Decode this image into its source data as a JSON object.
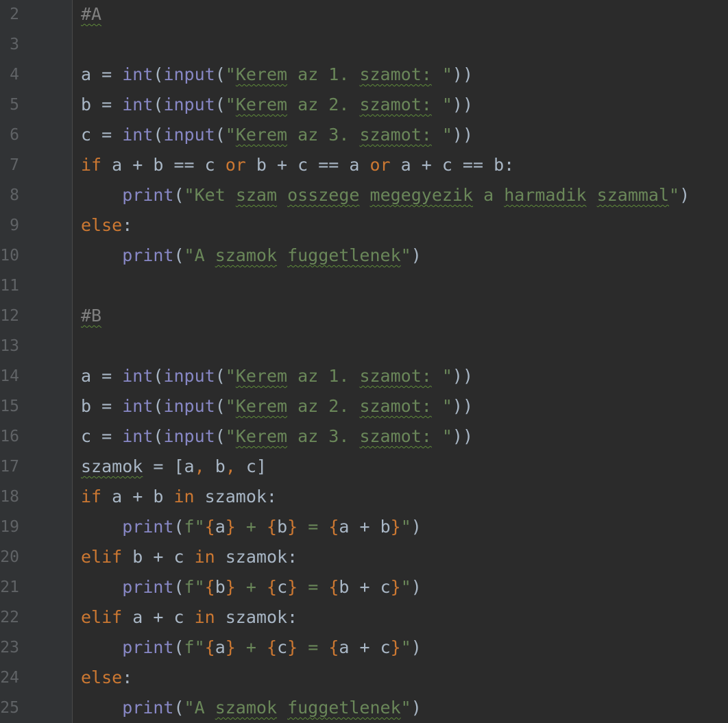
{
  "editor": {
    "lines": [
      {
        "n": "2",
        "tokens": [
          {
            "t": "#A",
            "c": "cm",
            "u": true
          }
        ]
      },
      {
        "n": "3",
        "tokens": []
      },
      {
        "n": "4",
        "tokens": [
          {
            "t": "a = "
          },
          {
            "t": "int",
            "c": "bi"
          },
          {
            "t": "("
          },
          {
            "t": "input",
            "c": "bi"
          },
          {
            "t": "("
          },
          {
            "t": "\"",
            "c": "str"
          },
          {
            "t": "Kerem",
            "c": "str",
            "u": true
          },
          {
            "t": " az 1. ",
            "c": "str"
          },
          {
            "t": "szamot:",
            "c": "str",
            "u": true
          },
          {
            "t": " \"",
            "c": "str"
          },
          {
            "t": "))"
          }
        ]
      },
      {
        "n": "5",
        "tokens": [
          {
            "t": "b = "
          },
          {
            "t": "int",
            "c": "bi"
          },
          {
            "t": "("
          },
          {
            "t": "input",
            "c": "bi"
          },
          {
            "t": "("
          },
          {
            "t": "\"",
            "c": "str"
          },
          {
            "t": "Kerem",
            "c": "str",
            "u": true
          },
          {
            "t": " az 2. ",
            "c": "str"
          },
          {
            "t": "szamot:",
            "c": "str",
            "u": true
          },
          {
            "t": " \"",
            "c": "str"
          },
          {
            "t": "))"
          }
        ]
      },
      {
        "n": "6",
        "tokens": [
          {
            "t": "c = "
          },
          {
            "t": "int",
            "c": "bi"
          },
          {
            "t": "("
          },
          {
            "t": "input",
            "c": "bi"
          },
          {
            "t": "("
          },
          {
            "t": "\"",
            "c": "str"
          },
          {
            "t": "Kerem",
            "c": "str",
            "u": true
          },
          {
            "t": " az 3. ",
            "c": "str"
          },
          {
            "t": "szamot:",
            "c": "str",
            "u": true
          },
          {
            "t": " \"",
            "c": "str"
          },
          {
            "t": "))"
          }
        ]
      },
      {
        "n": "7",
        "tokens": [
          {
            "t": "if",
            "c": "kw"
          },
          {
            "t": " a + b == c "
          },
          {
            "t": "or",
            "c": "kw"
          },
          {
            "t": " b + c == a "
          },
          {
            "t": "or",
            "c": "kw"
          },
          {
            "t": " a + c == b:"
          }
        ]
      },
      {
        "n": "8",
        "tokens": [
          {
            "t": "    "
          },
          {
            "t": "print",
            "c": "bi"
          },
          {
            "t": "("
          },
          {
            "t": "\"Ket ",
            "c": "str"
          },
          {
            "t": "szam",
            "c": "str",
            "u": true
          },
          {
            "t": " ",
            "c": "str"
          },
          {
            "t": "osszege",
            "c": "str",
            "u": true
          },
          {
            "t": " ",
            "c": "str"
          },
          {
            "t": "megegyezik",
            "c": "str",
            "u": true
          },
          {
            "t": " a ",
            "c": "str"
          },
          {
            "t": "harmadik",
            "c": "str",
            "u": true
          },
          {
            "t": " ",
            "c": "str"
          },
          {
            "t": "szammal",
            "c": "str",
            "u": true
          },
          {
            "t": "\"",
            "c": "str"
          },
          {
            "t": ")"
          }
        ]
      },
      {
        "n": "9",
        "tokens": [
          {
            "t": "else",
            "c": "kw"
          },
          {
            "t": ":"
          }
        ]
      },
      {
        "n": "10",
        "tokens": [
          {
            "t": "    "
          },
          {
            "t": "print",
            "c": "bi"
          },
          {
            "t": "("
          },
          {
            "t": "\"A ",
            "c": "str"
          },
          {
            "t": "szamok",
            "c": "str",
            "u": true
          },
          {
            "t": " ",
            "c": "str"
          },
          {
            "t": "fuggetlenek",
            "c": "str",
            "u": true
          },
          {
            "t": "\"",
            "c": "str"
          },
          {
            "t": ")"
          }
        ]
      },
      {
        "n": "11",
        "tokens": []
      },
      {
        "n": "12",
        "tokens": [
          {
            "t": "#B",
            "c": "cm",
            "u": true
          }
        ]
      },
      {
        "n": "13",
        "tokens": []
      },
      {
        "n": "14",
        "tokens": [
          {
            "t": "a = "
          },
          {
            "t": "int",
            "c": "bi"
          },
          {
            "t": "("
          },
          {
            "t": "input",
            "c": "bi"
          },
          {
            "t": "("
          },
          {
            "t": "\"",
            "c": "str"
          },
          {
            "t": "Kerem",
            "c": "str",
            "u": true
          },
          {
            "t": " az 1. ",
            "c": "str"
          },
          {
            "t": "szamot:",
            "c": "str",
            "u": true
          },
          {
            "t": " \"",
            "c": "str"
          },
          {
            "t": "))"
          }
        ]
      },
      {
        "n": "15",
        "tokens": [
          {
            "t": "b = "
          },
          {
            "t": "int",
            "c": "bi"
          },
          {
            "t": "("
          },
          {
            "t": "input",
            "c": "bi"
          },
          {
            "t": "("
          },
          {
            "t": "\"",
            "c": "str"
          },
          {
            "t": "Kerem",
            "c": "str",
            "u": true
          },
          {
            "t": " az 2. ",
            "c": "str"
          },
          {
            "t": "szamot:",
            "c": "str",
            "u": true
          },
          {
            "t": " \"",
            "c": "str"
          },
          {
            "t": "))"
          }
        ]
      },
      {
        "n": "16",
        "tokens": [
          {
            "t": "c = "
          },
          {
            "t": "int",
            "c": "bi"
          },
          {
            "t": "("
          },
          {
            "t": "input",
            "c": "bi"
          },
          {
            "t": "("
          },
          {
            "t": "\"",
            "c": "str"
          },
          {
            "t": "Kerem",
            "c": "str",
            "u": true
          },
          {
            "t": " az 3. ",
            "c": "str"
          },
          {
            "t": "szamot:",
            "c": "str",
            "u": true
          },
          {
            "t": " \"",
            "c": "str"
          },
          {
            "t": "))"
          }
        ]
      },
      {
        "n": "17",
        "tokens": [
          {
            "t": "szamok",
            "u": true
          },
          {
            "t": " = [a"
          },
          {
            "t": ",",
            "c": "kw"
          },
          {
            "t": " b"
          },
          {
            "t": ",",
            "c": "kw"
          },
          {
            "t": " c]"
          }
        ]
      },
      {
        "n": "18",
        "tokens": [
          {
            "t": "if",
            "c": "kw"
          },
          {
            "t": " a + b "
          },
          {
            "t": "in",
            "c": "kw"
          },
          {
            "t": " szamok:"
          }
        ]
      },
      {
        "n": "19",
        "tokens": [
          {
            "t": "    "
          },
          {
            "t": "print",
            "c": "bi"
          },
          {
            "t": "("
          },
          {
            "t": "f\"",
            "c": "str"
          },
          {
            "t": "{",
            "c": "kw"
          },
          {
            "t": "a"
          },
          {
            "t": "}",
            "c": "kw"
          },
          {
            "t": " + ",
            "c": "str"
          },
          {
            "t": "{",
            "c": "kw"
          },
          {
            "t": "b"
          },
          {
            "t": "}",
            "c": "kw"
          },
          {
            "t": " = ",
            "c": "str"
          },
          {
            "t": "{",
            "c": "kw"
          },
          {
            "t": "a + b"
          },
          {
            "t": "}",
            "c": "kw"
          },
          {
            "t": "\"",
            "c": "str"
          },
          {
            "t": ")"
          }
        ]
      },
      {
        "n": "20",
        "tokens": [
          {
            "t": "elif",
            "c": "kw"
          },
          {
            "t": " b + c "
          },
          {
            "t": "in",
            "c": "kw"
          },
          {
            "t": " szamok:"
          }
        ]
      },
      {
        "n": "21",
        "tokens": [
          {
            "t": "    "
          },
          {
            "t": "print",
            "c": "bi"
          },
          {
            "t": "("
          },
          {
            "t": "f\"",
            "c": "str"
          },
          {
            "t": "{",
            "c": "kw"
          },
          {
            "t": "b"
          },
          {
            "t": "}",
            "c": "kw"
          },
          {
            "t": " + ",
            "c": "str"
          },
          {
            "t": "{",
            "c": "kw"
          },
          {
            "t": "c"
          },
          {
            "t": "}",
            "c": "kw"
          },
          {
            "t": " = ",
            "c": "str"
          },
          {
            "t": "{",
            "c": "kw"
          },
          {
            "t": "b + c"
          },
          {
            "t": "}",
            "c": "kw"
          },
          {
            "t": "\"",
            "c": "str"
          },
          {
            "t": ")"
          }
        ]
      },
      {
        "n": "22",
        "tokens": [
          {
            "t": "elif",
            "c": "kw"
          },
          {
            "t": " a + c "
          },
          {
            "t": "in",
            "c": "kw"
          },
          {
            "t": " szamok:"
          }
        ]
      },
      {
        "n": "23",
        "tokens": [
          {
            "t": "    "
          },
          {
            "t": "print",
            "c": "bi"
          },
          {
            "t": "("
          },
          {
            "t": "f\"",
            "c": "str"
          },
          {
            "t": "{",
            "c": "kw"
          },
          {
            "t": "a"
          },
          {
            "t": "}",
            "c": "kw"
          },
          {
            "t": " + ",
            "c": "str"
          },
          {
            "t": "{",
            "c": "kw"
          },
          {
            "t": "c"
          },
          {
            "t": "}",
            "c": "kw"
          },
          {
            "t": " = ",
            "c": "str"
          },
          {
            "t": "{",
            "c": "kw"
          },
          {
            "t": "a + c"
          },
          {
            "t": "}",
            "c": "kw"
          },
          {
            "t": "\"",
            "c": "str"
          },
          {
            "t": ")"
          }
        ]
      },
      {
        "n": "24",
        "tokens": [
          {
            "t": "else",
            "c": "kw"
          },
          {
            "t": ":"
          }
        ]
      },
      {
        "n": "25",
        "tokens": [
          {
            "t": "    "
          },
          {
            "t": "print",
            "c": "bi"
          },
          {
            "t": "("
          },
          {
            "t": "\"A ",
            "c": "str"
          },
          {
            "t": "szamok",
            "c": "str",
            "u": true
          },
          {
            "t": " ",
            "c": "str"
          },
          {
            "t": "fuggetlenek",
            "c": "str",
            "u": true
          },
          {
            "t": "\"",
            "c": "str"
          },
          {
            "t": ")"
          }
        ]
      }
    ]
  },
  "colors": {
    "background": "#2b2b2b",
    "gutter": "#313335",
    "line_number": "#606366",
    "default": "#a9b7c6",
    "keyword": "#cc7832",
    "builtin": "#8888c6",
    "string": "#6a8759",
    "comment": "#808080",
    "typo_underline": "#5e8a3a"
  }
}
